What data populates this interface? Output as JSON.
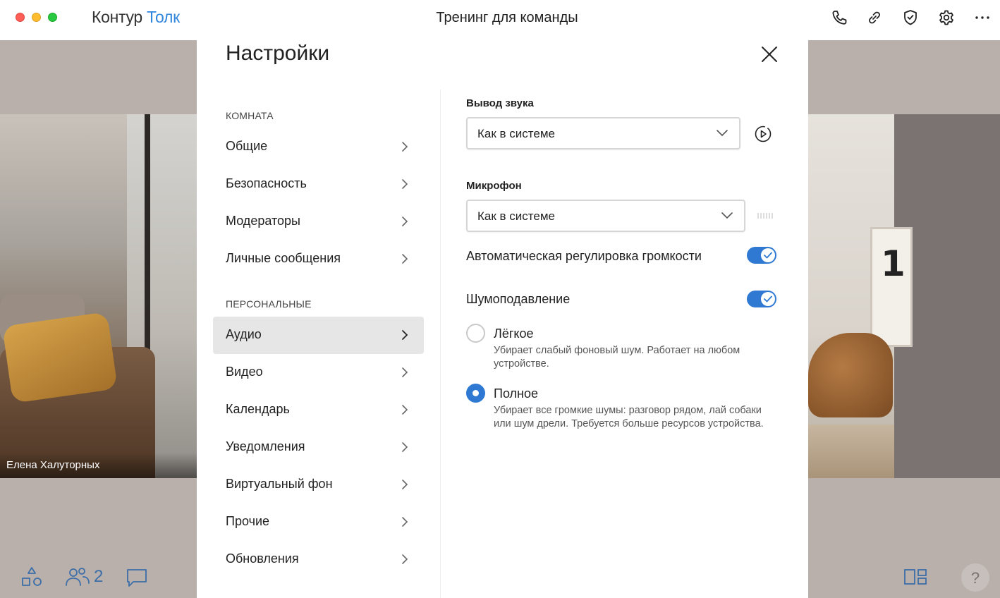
{
  "app": {
    "brand_part1": "Контур",
    "brand_part2": "Толк",
    "window_title": "Тренинг для команды",
    "toolbar_icons": [
      "phone-icon",
      "link-icon",
      "shield-check-icon",
      "gear-icon",
      "more-icon"
    ],
    "brand_accent": "#2f86dd"
  },
  "video": {
    "participant_name": "Елена Халуторных"
  },
  "bottom_bar": {
    "participants_count": "2",
    "help_label": "?"
  },
  "settings": {
    "title": "Настройки",
    "section_room": "КОМНАТА",
    "room_items": [
      {
        "label": "Общие"
      },
      {
        "label": "Безопасность"
      },
      {
        "label": "Модераторы"
      },
      {
        "label": "Личные сообщения"
      }
    ],
    "section_personal": "ПЕРСОНАЛЬНЫЕ",
    "personal_items": [
      {
        "label": "Аудио",
        "active": true
      },
      {
        "label": "Видео"
      },
      {
        "label": "Календарь"
      },
      {
        "label": "Уведомления"
      },
      {
        "label": "Виртуальный фон"
      },
      {
        "label": "Прочие"
      },
      {
        "label": "Обновления"
      }
    ]
  },
  "audio": {
    "output_label": "Вывод звука",
    "output_value": "Как в системе",
    "mic_label": "Микрофон",
    "mic_value": "Как в системе",
    "agc_label": "Автоматическая регулировка громкости",
    "agc_enabled": true,
    "noise_label": "Шумоподавление",
    "noise_enabled": true,
    "noise_options": [
      {
        "title": "Лёгкое",
        "description": "Убирает слабый фоновый шум. Работает на любом устройстве.",
        "selected": false
      },
      {
        "title": "Полное",
        "description": "Убирает все громкие шумы: разговор рядом, лай собаки или шум дрели. Требуется больше ресурсов устройства.",
        "selected": true
      }
    ],
    "accent": "#2f79d3"
  }
}
